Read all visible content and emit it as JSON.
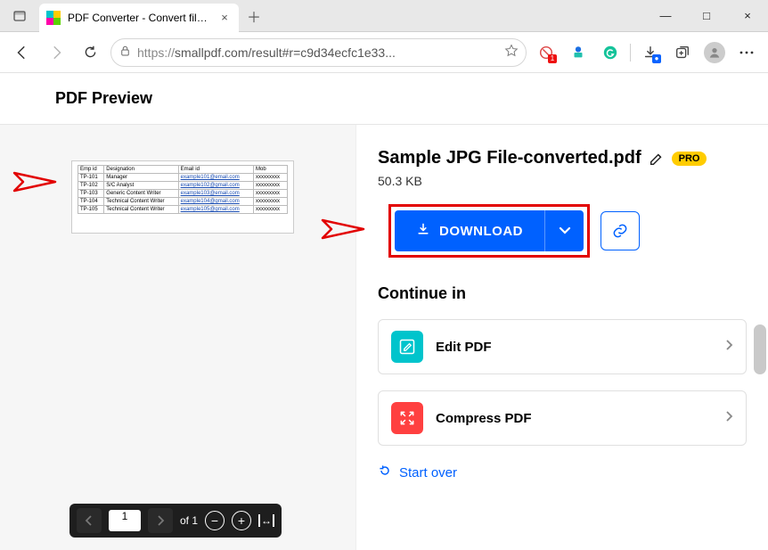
{
  "window": {
    "tab_title": "PDF Converter - Convert files to",
    "close": "×",
    "minimize": "—",
    "maximize": "□"
  },
  "addr": {
    "url_prefix": "https://",
    "url_rest": "smallpdf.com/result#r=c9d34ecfc1e33..."
  },
  "header": {
    "title": "PDF Preview"
  },
  "file": {
    "name": "Sample JPG File-converted.pdf",
    "size": "50.3 KB",
    "pro": "PRO"
  },
  "download": {
    "label": "DOWNLOAD"
  },
  "continue": {
    "heading": "Continue in",
    "edit": "Edit PDF",
    "compress": "Compress PDF"
  },
  "start_over": "Start over",
  "pager": {
    "current": "1",
    "of": "of 1"
  },
  "thumb_headers": {
    "c1": "Emp id",
    "c2": "Designation",
    "c3": "Email id",
    "c4": "Mob"
  },
  "thumb_rows": [
    {
      "c1": "TP-101",
      "c2": "Manager",
      "c3": "example101@email.com",
      "c4": "xxxxxxxxx"
    },
    {
      "c1": "TP-102",
      "c2": "S/C Analyst",
      "c3": "example102@gmail.com",
      "c4": "xxxxxxxxx"
    },
    {
      "c1": "TP-103",
      "c2": "Generic Content Writer",
      "c3": "example103@email.com",
      "c4": "xxxxxxxxx"
    },
    {
      "c1": "TP-104",
      "c2": "Technical Content Writer",
      "c3": "example104@gmail.com",
      "c4": "xxxxxxxxx"
    },
    {
      "c1": "TP-105",
      "c2": "Technical Content Writer",
      "c3": "example105@gmail.com",
      "c4": "xxxxxxxxx"
    }
  ]
}
